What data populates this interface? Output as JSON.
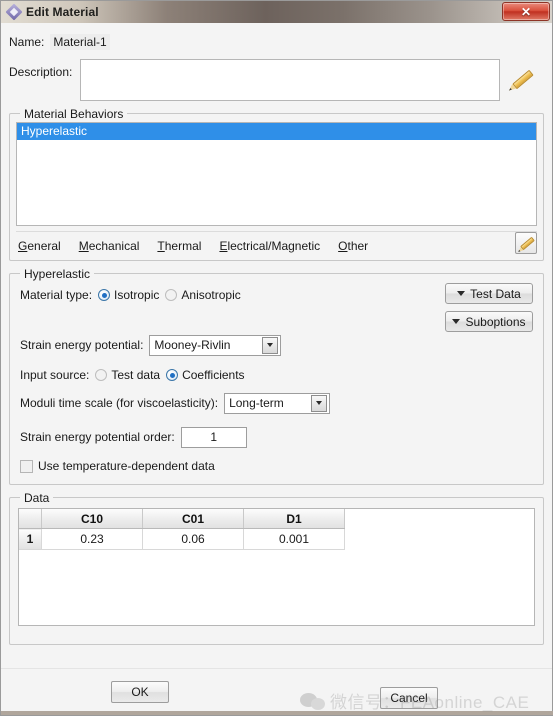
{
  "window": {
    "title": "Edit Material",
    "title_icon": "diamond-icon",
    "close_label": "✕"
  },
  "name_field": {
    "label": "Name:",
    "value": "Material-1"
  },
  "description_field": {
    "label": "Description:",
    "value": "",
    "placeholder": "",
    "edit_icon": "pencil-icon"
  },
  "material_behaviors": {
    "title": "Material Behaviors",
    "items": [
      {
        "label": "Hyperelastic",
        "selected": true
      }
    ],
    "menu": [
      {
        "mnemonic": "G",
        "rest": "eneral"
      },
      {
        "mnemonic": "M",
        "rest": "echanical"
      },
      {
        "mnemonic": "T",
        "rest": "hermal"
      },
      {
        "mnemonic": "E",
        "rest": "lectrical/Magnetic"
      },
      {
        "mnemonic": "O",
        "rest": "ther"
      }
    ],
    "edit_icon": "pencil-icon"
  },
  "hyperelastic": {
    "title": "Hyperelastic",
    "material_type": {
      "label": "Material type:",
      "options": [
        {
          "label": "Isotropic",
          "selected": true
        },
        {
          "label": "Anisotropic",
          "selected": false
        }
      ]
    },
    "test_data_button": "Test Data",
    "suboptions_button": "Suboptions",
    "strain_energy_potential": {
      "label": "Strain energy potential:",
      "value": "Mooney-Rivlin"
    },
    "input_source": {
      "label": "Input source:",
      "options": [
        {
          "label": "Test data",
          "selected": false
        },
        {
          "label": "Coefficients",
          "selected": true
        }
      ]
    },
    "moduli_time_scale": {
      "label": "Moduli time scale (for viscoelasticity):",
      "value": "Long-term"
    },
    "strain_energy_order": {
      "label": "Strain energy potential order:",
      "value": "1"
    },
    "temperature_dependent": {
      "label": "Use temperature-dependent data",
      "checked": false
    }
  },
  "data_section": {
    "title": "Data",
    "columns": [
      "C10",
      "C01",
      "D1"
    ],
    "rows": [
      {
        "index": "1",
        "values": [
          "0.23",
          "0.06",
          "0.001"
        ]
      }
    ]
  },
  "footer": {
    "ok_label": "OK",
    "cancel_label": "Cancel"
  },
  "watermark": {
    "icon": "wechat-icon",
    "text": "微信号：FEAonline_CAE"
  },
  "colors": {
    "selection_blue": "#2f8fe8",
    "close_red": "#d9503c",
    "accent_pencil": "#f3c85e"
  }
}
